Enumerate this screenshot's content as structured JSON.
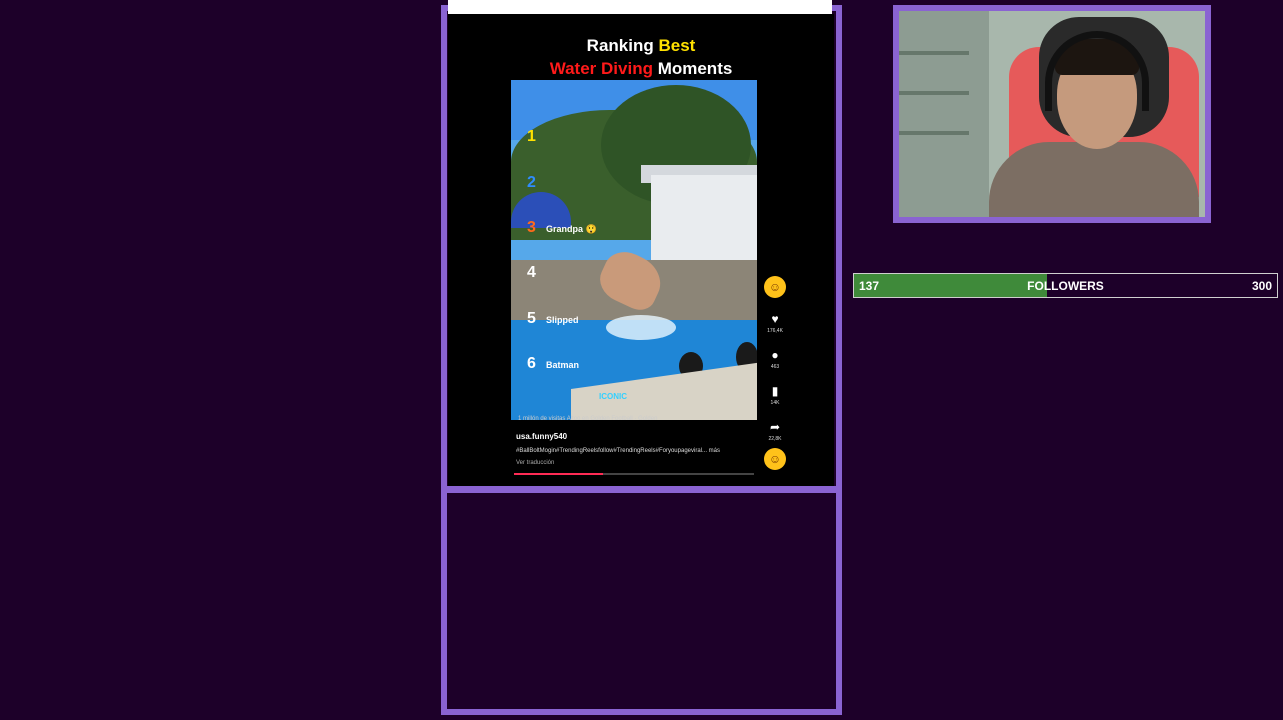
{
  "video": {
    "title_line1_white": "Ranking ",
    "title_line1_yellow": "Best",
    "title_line2_red": "Water Diving",
    "title_line2_white": " Moments",
    "rankings": [
      {
        "num": "1",
        "label": "",
        "color": "#ffe100"
      },
      {
        "num": "2",
        "label": "",
        "color": "#2f8cff"
      },
      {
        "num": "3",
        "label": "Grandpa 😲",
        "color": "#ff6a1a"
      },
      {
        "num": "4",
        "label": "",
        "color": "#ffffff"
      },
      {
        "num": "5",
        "label": "Slipped",
        "color": "#ffffff"
      },
      {
        "num": "6",
        "label": "Batman",
        "color": "#ffffff"
      }
    ],
    "watermark": "ICONIC",
    "music": "1 millón de visitas Altoo en Golden Football · Golden",
    "username": "usa.funny540",
    "hashtags": "#BallBoltMogin#TrendingReelsfollow#TrendingReels#Foryoupageviral... más",
    "translate": "Ver traducción",
    "progress_fraction": 0.37,
    "side": {
      "likes": "176,4K",
      "comments": "463",
      "saves": "14K",
      "shares": "22,8K"
    }
  },
  "followers_goal": {
    "current": "137",
    "label": "FOLLOWERS",
    "target": "300",
    "fraction": 0.457,
    "fill_color": "#3f8a3a"
  },
  "colors": {
    "frame": "#8a63d2",
    "background": "#1d0029"
  }
}
